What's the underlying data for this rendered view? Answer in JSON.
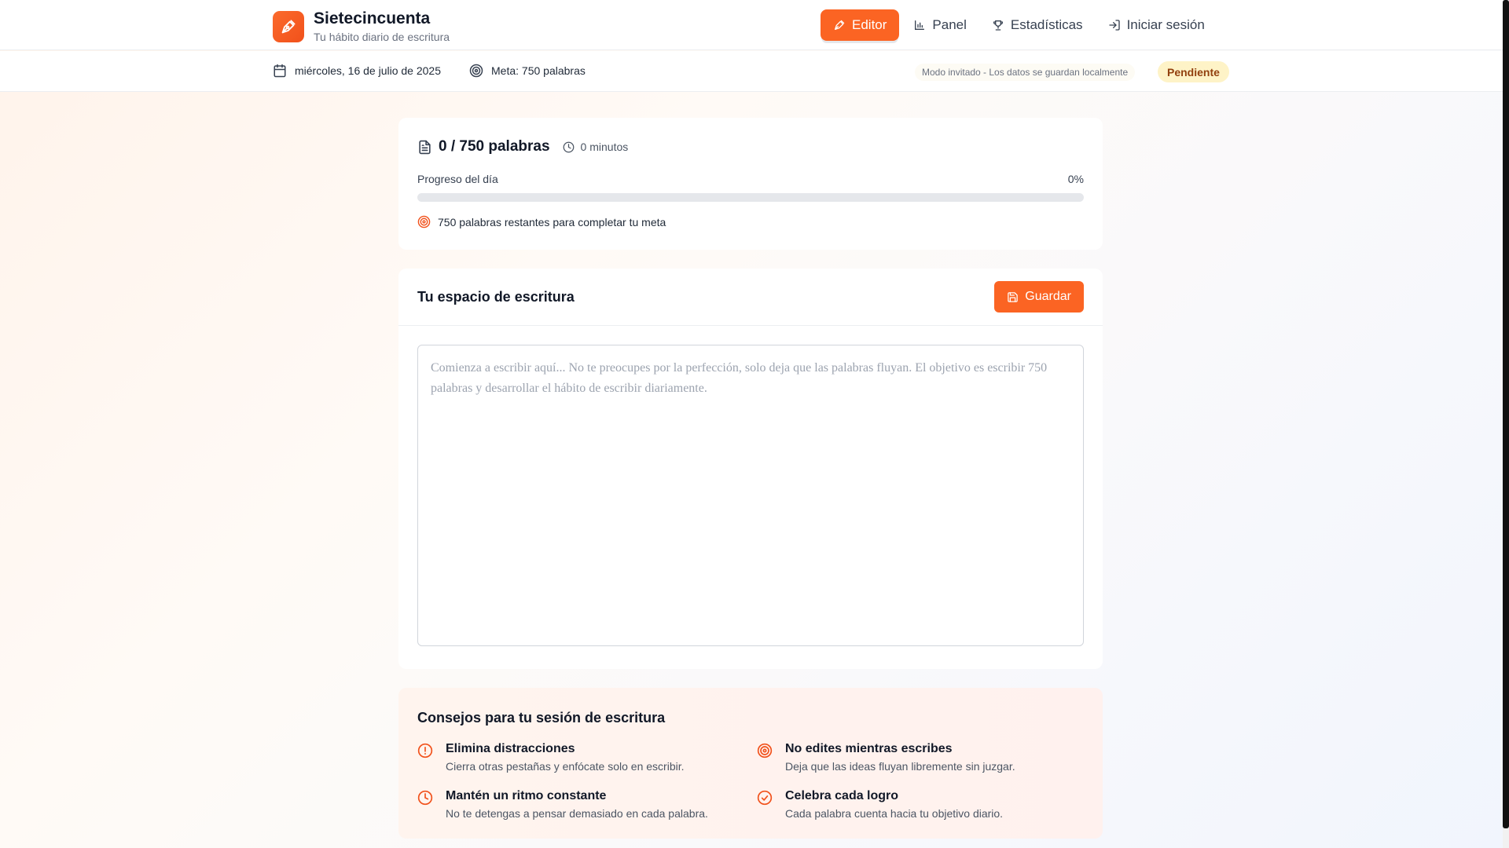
{
  "app": {
    "title": "Sietecincuenta",
    "subtitle": "Tu hábito diario de escritura"
  },
  "nav": {
    "items": [
      {
        "label": "Editor",
        "icon": "pen-icon",
        "active": true
      },
      {
        "label": "Panel",
        "icon": "bar-chart-icon",
        "active": false
      },
      {
        "label": "Estadísticas",
        "icon": "trophy-icon",
        "active": false
      },
      {
        "label": "Iniciar sesión",
        "icon": "login-icon",
        "active": false
      }
    ]
  },
  "subbar": {
    "date": "miércoles, 16 de julio de 2025",
    "goal": "Meta: 750 palabras",
    "guest_note": "Modo invitado - Los datos se guardan localmente",
    "status": "Pendiente"
  },
  "progress": {
    "count": "0 / 750 palabras",
    "time": "0 minutos",
    "label": "Progreso del día",
    "percent_text": "0%",
    "fraction": 0,
    "remaining": "750 palabras restantes para completar tu meta"
  },
  "editor": {
    "title": "Tu espacio de escritura",
    "save_label": "Guardar",
    "value": "",
    "placeholder": "Comienza a escribir aquí... No te preocupes por la perfección, solo deja que las palabras fluyan. El objetivo es escribir 750 palabras y desarrollar el hábito de escribir diariamente."
  },
  "tips": {
    "title": "Consejos para tu sesión de escritura",
    "items": [
      {
        "title": "Elimina distracciones",
        "desc": "Cierra otras pestañas y enfócate solo en escribir.",
        "icon": "alert-circle-icon"
      },
      {
        "title": "No edites mientras escribes",
        "desc": "Deja que las ideas fluyan libremente sin juzgar.",
        "icon": "target-icon"
      },
      {
        "title": "Mantén un ritmo constante",
        "desc": "No te detengas a pensar demasiado en cada palabra.",
        "icon": "clock-icon"
      },
      {
        "title": "Celebra cada logro",
        "desc": "Cada palabra cuenta hacia tu objetivo diario.",
        "icon": "check-circle-icon"
      }
    ]
  },
  "colors": {
    "accent": "#fb6423",
    "status_bg": "#fef3c7",
    "status_text": "#92400e"
  }
}
